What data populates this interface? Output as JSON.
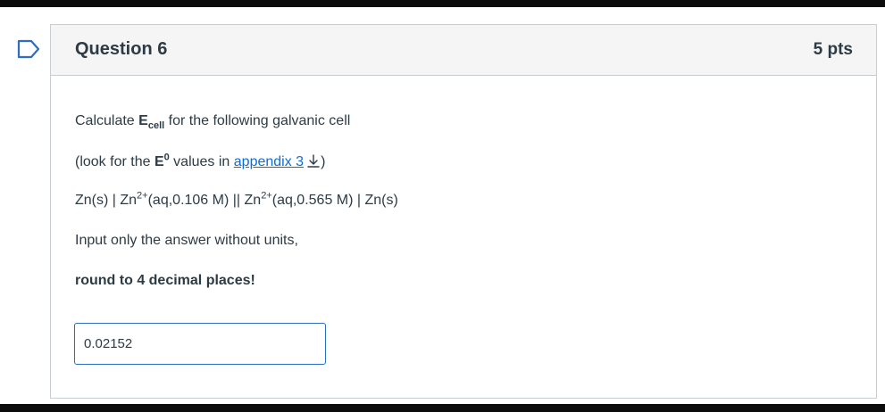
{
  "question": {
    "title": "Question 6",
    "points": "5 pts",
    "prompt_prefix": "Calculate ",
    "prompt_E": "E",
    "prompt_E_sub": "cell",
    "prompt_suffix": " for the following galvanic cell",
    "hint_prefix": "(look for the ",
    "hint_E": "E",
    "hint_E_sup": "0",
    "hint_middle": " values in ",
    "hint_link": "appendix 3",
    "hint_suffix": ")",
    "cell_part1": "Zn(s) | Zn",
    "cell_sup1": "2+",
    "cell_part2": "(aq,0.106 M) || Zn",
    "cell_sup2": "2+",
    "cell_part3": "(aq,0.565 M) | Zn(s)",
    "instruction": "Input only the answer without units,",
    "rounding": "round to 4 decimal places!",
    "answer_value": "0.02152"
  },
  "icons": {
    "flag": "bookmark-flag-icon",
    "download": "download-icon"
  },
  "colors": {
    "accent": "#0b6ed9",
    "flag": "#2d6ec2",
    "border": "#c7cdd1",
    "header_bg": "#f5f5f5"
  }
}
